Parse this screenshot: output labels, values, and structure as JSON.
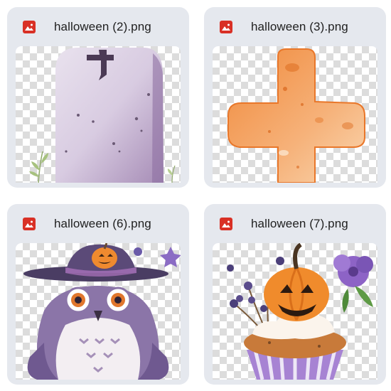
{
  "files": [
    {
      "name": "halloween (2).png",
      "icon": "image-file-icon",
      "preview": "tombstone-with-cross"
    },
    {
      "name": "halloween (3).png",
      "icon": "image-file-icon",
      "preview": "orange-cross"
    },
    {
      "name": "halloween (6).png",
      "icon": "image-file-icon",
      "preview": "owl-in-witch-hat"
    },
    {
      "name": "halloween (7).png",
      "icon": "image-file-icon",
      "preview": "pumpkin-cupcake"
    }
  ],
  "colors": {
    "card_background": "#e5e8ee",
    "file_icon": "#d93025",
    "checker_light": "#ffffff",
    "checker_dark": "#dcdcdc"
  }
}
